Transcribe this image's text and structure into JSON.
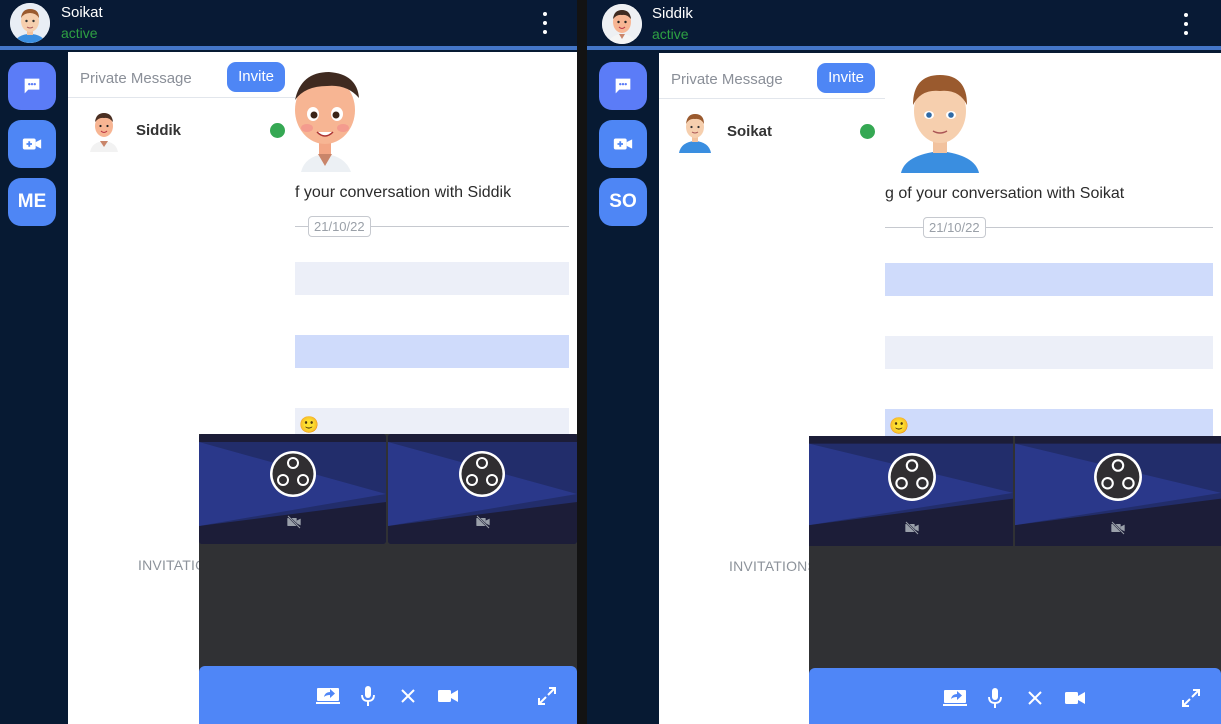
{
  "left": {
    "header": {
      "name": "Soikat",
      "status": "active",
      "avatar_icon": "user-avatar-soikat-icon",
      "menu_icon": "kebab-menu-icon"
    },
    "rail": {
      "chat_icon": "chat-bubble-icon",
      "video_icon": "video-call-icon",
      "profile_initials": "ME"
    },
    "panel": {
      "title": "Private Message",
      "invite_label": "Invite",
      "contacts": [
        {
          "name": "Siddik",
          "online": true
        }
      ],
      "invitations_label": "INVITATIONS"
    },
    "chat": {
      "conversation_text": "f your conversation with Siddik",
      "date": "21/10/22",
      "emoji": "🙂"
    }
  },
  "right": {
    "header": {
      "name": "Siddik",
      "status": "active",
      "avatar_icon": "user-avatar-siddik-icon",
      "menu_icon": "kebab-menu-icon"
    },
    "rail": {
      "chat_icon": "chat-bubble-icon",
      "video_icon": "video-call-icon",
      "profile_initials": "SO"
    },
    "panel": {
      "title": "Private Message",
      "invite_label": "Invite",
      "contacts": [
        {
          "name": "Soikat",
          "online": true
        }
      ],
      "invitations_label": "INVITATIONS"
    },
    "chat": {
      "conversation_text": "g of your conversation with Soikat",
      "date": "21/10/22",
      "emoji": "🙂"
    }
  },
  "call_controls": [
    "share-screen-icon",
    "microphone-icon",
    "close-icon",
    "camera-icon",
    "fullscreen-icon"
  ],
  "colors": {
    "accent": "#4e86f5",
    "rail_button": "#5b7cf7",
    "online": "#35a853",
    "status_text": "#2ea043",
    "dark_bg": "#071a33"
  }
}
